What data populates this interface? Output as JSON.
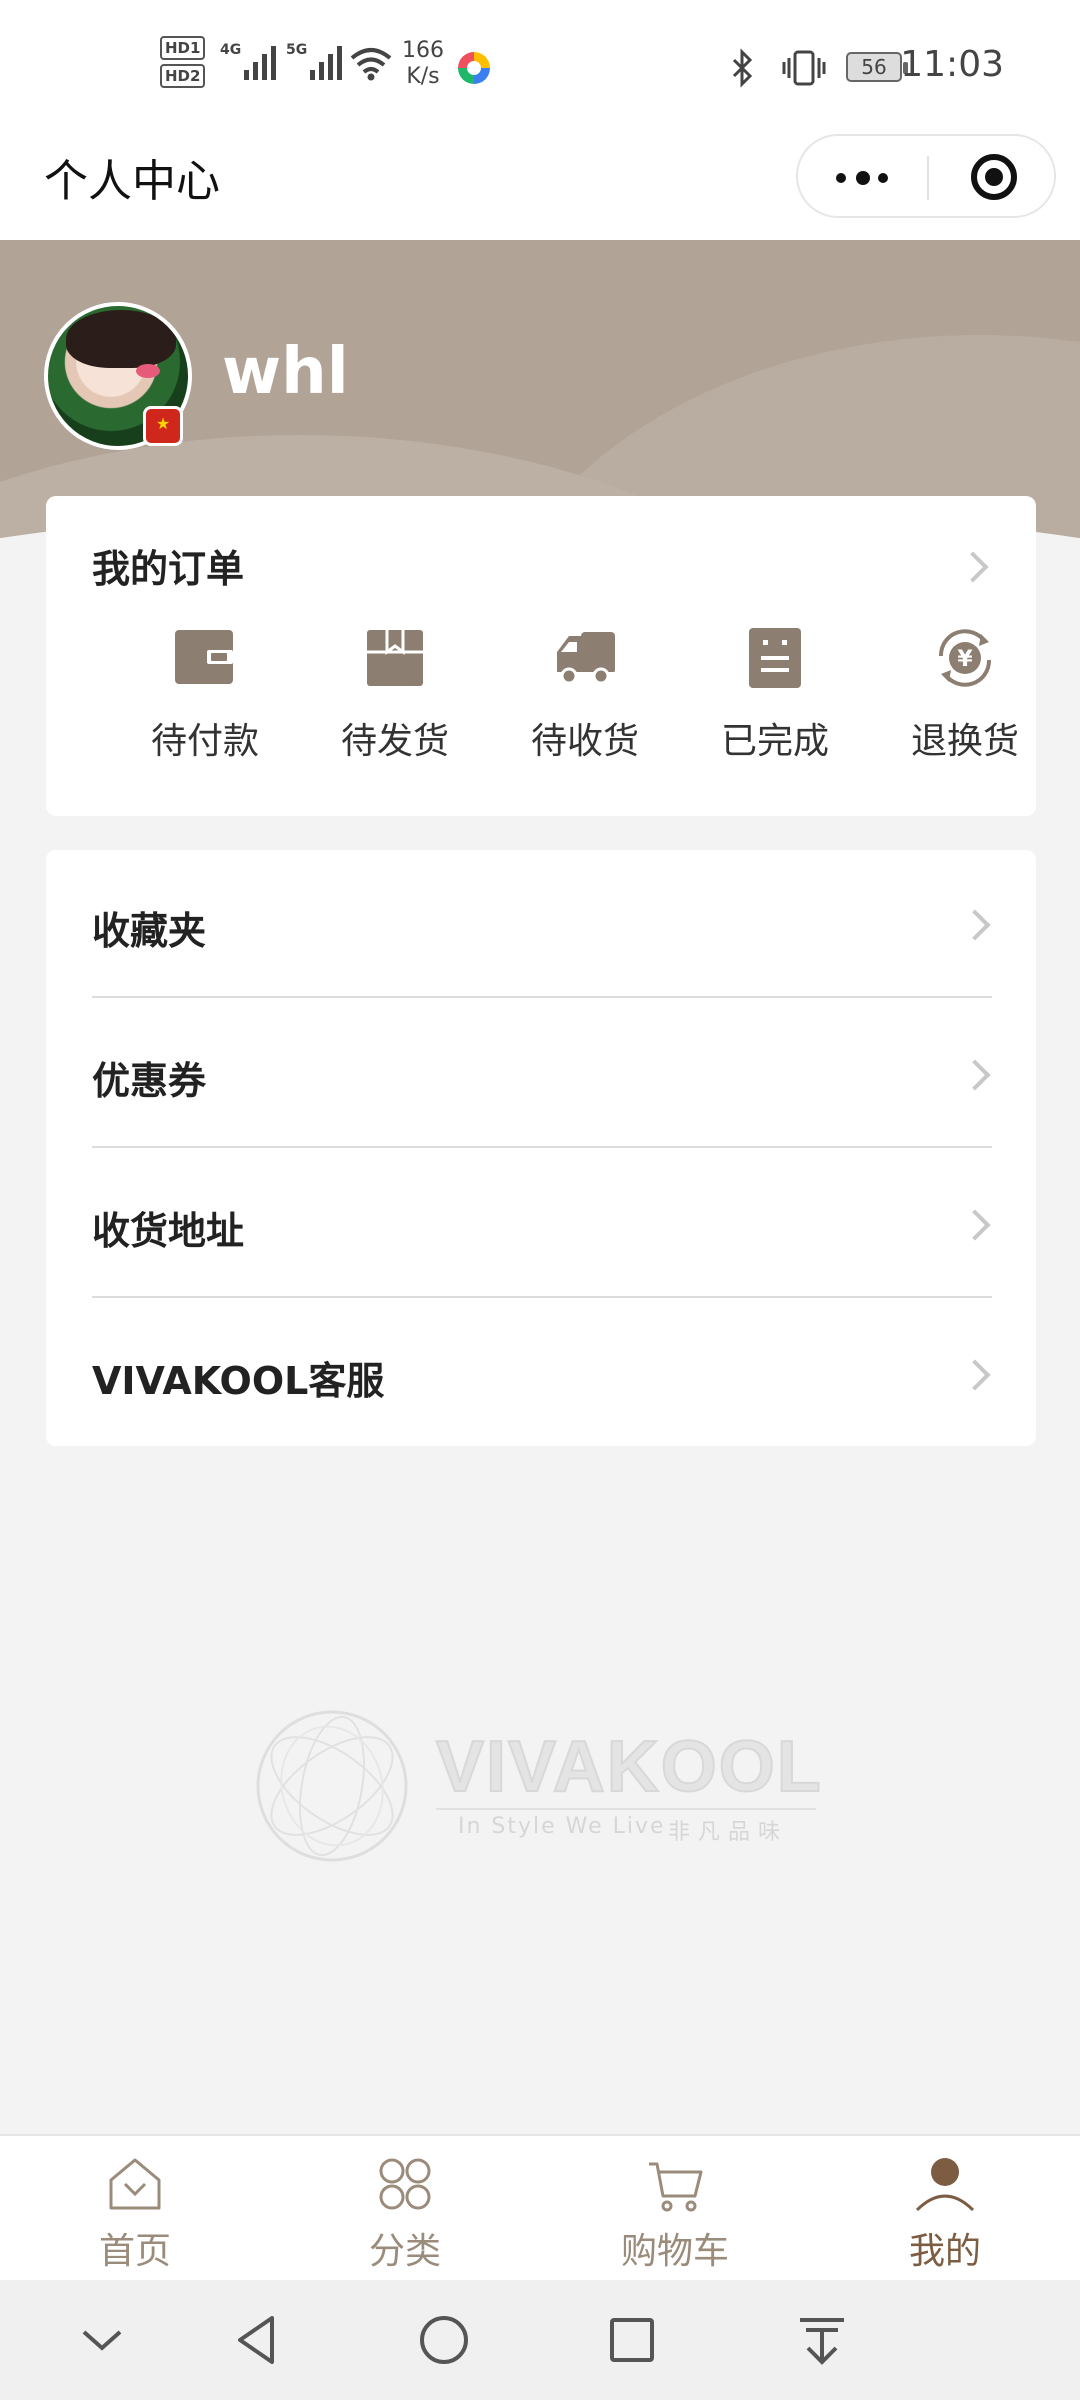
{
  "status_bar": {
    "hd1": "HD1",
    "hd2": "HD2",
    "sim1": "4G",
    "sim2": "5G",
    "net_speed_value": "166",
    "net_speed_unit": "K/s",
    "battery": "56",
    "time": "11:03"
  },
  "header": {
    "title": "个人中心"
  },
  "profile": {
    "username": "whl"
  },
  "orders": {
    "title": "我的订单",
    "items": [
      {
        "label": "待付款",
        "icon": "wallet-icon"
      },
      {
        "label": "待发货",
        "icon": "package-icon"
      },
      {
        "label": "待收货",
        "icon": "truck-icon"
      },
      {
        "label": "已完成",
        "icon": "receipt-icon"
      },
      {
        "label": "退换货",
        "icon": "yuan-exchange-icon"
      }
    ]
  },
  "menu": {
    "items": [
      {
        "label": "收藏夹"
      },
      {
        "label": "优惠券"
      },
      {
        "label": "收货地址"
      },
      {
        "label": "VIVAKOOL客服"
      }
    ]
  },
  "brand": {
    "name": "VIVAKOOL",
    "tagline": "In Style We Live",
    "tagline_cn": "非凡品味"
  },
  "tabbar": {
    "active": "我的",
    "items": [
      {
        "label": "首页",
        "icon": "home-icon"
      },
      {
        "label": "分类",
        "icon": "category-icon"
      },
      {
        "label": "购物车",
        "icon": "cart-icon"
      },
      {
        "label": "我的",
        "icon": "profile-icon"
      }
    ]
  },
  "colors": {
    "brand": "#b1a497",
    "icon": "#8c7f72",
    "active_tab": "#7d5d42"
  }
}
